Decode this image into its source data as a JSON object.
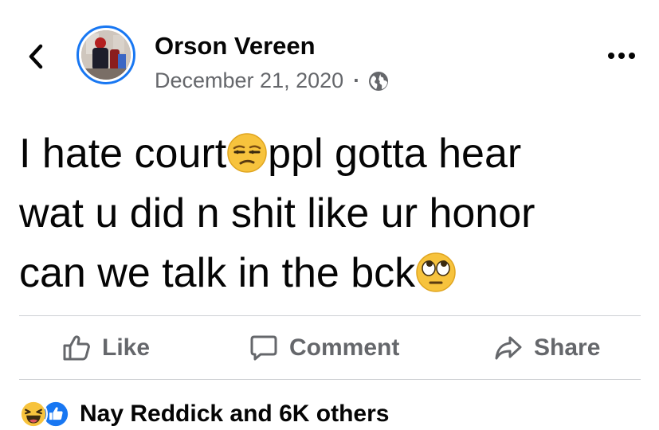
{
  "post": {
    "author": "Orson Vereen",
    "date": "December 21, 2020",
    "separator": "·",
    "privacy_icon": "globe-icon",
    "text_line1_a": "I hate court",
    "text_line1_b": "ppl gotta hear",
    "text_line2": "wat u did n shit like ur honor",
    "text_line3": "can we talk in the bck",
    "emoji_1": "unamused-face",
    "emoji_2": "face-with-rolling-eyes"
  },
  "actions": {
    "like_label": "Like",
    "comment_label": "Comment",
    "share_label": "Share"
  },
  "reactions": {
    "icons": [
      "laughing-face",
      "like-thumb"
    ],
    "summary": "Nay Reddick and 6K others"
  },
  "colors": {
    "accent": "#1877f2",
    "secondary_text": "#65676b",
    "divider": "#ced0d4"
  }
}
